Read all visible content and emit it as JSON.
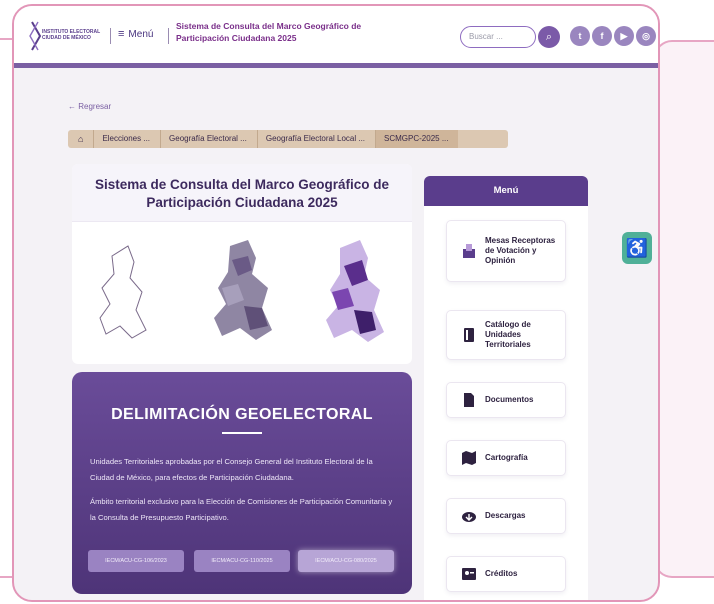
{
  "header": {
    "logo_text": "INSTITUTO ELECTORAL CIUDAD DE MÉXICO",
    "menu_label": "Menú",
    "site_title": "Sistema de Consulta del Marco Geográfico de Participación Ciudadana 2025",
    "search_placeholder": "Buscar ...",
    "social": [
      {
        "icon": "twitter-icon",
        "glyph": "t"
      },
      {
        "icon": "facebook-icon",
        "glyph": "f"
      },
      {
        "icon": "youtube-icon",
        "glyph": "▶"
      },
      {
        "icon": "instagram-icon",
        "glyph": "◎"
      }
    ]
  },
  "nav": {
    "back_label": "← Regresar",
    "breadcrumb": [
      "Elecciones ...",
      "Geografía Electoral ...",
      "Geografía Electoral Local ...",
      "SCMGPC-2025 ..."
    ]
  },
  "hero": {
    "title": "Sistema de Consulta del Marco Geográfico de Participación Ciudadana 2025"
  },
  "delimitation": {
    "title": "DELIMITACIÓN GEOELECTORAL",
    "paragraph1": "Unidades Territoriales aprobadas por el Consejo General del Instituto Electoral de la Ciudad de México, para efectos de Participación Ciudadana.",
    "paragraph2": "Ámbito territorial exclusivo para la Elección de Comisiones de Participación Comunitaria y la Consulta de Presupuesto Participativo.",
    "buttons": [
      "IECM/ACU-CG-106/2023",
      "IECM/ACU-CG-110/2025",
      "IECM/ACU-CG-080/2025"
    ]
  },
  "side_menu": {
    "title": "Menú",
    "items": [
      {
        "label": "Mesas Receptoras de Votación y Opinión",
        "icon": "ballot-box-icon"
      },
      {
        "label": "Catálogo de Unidades Territoriales",
        "icon": "book-icon"
      },
      {
        "label": "Documentos",
        "icon": "document-icon"
      },
      {
        "label": "Cartografía",
        "icon": "map-icon"
      },
      {
        "label": "Descargas",
        "icon": "cloud-download-icon"
      },
      {
        "label": "Créditos",
        "icon": "id-card-icon"
      }
    ]
  },
  "colors": {
    "accent": "#5a3d8c",
    "border_pink": "#e296b8",
    "accessibility": "#4fb098"
  }
}
